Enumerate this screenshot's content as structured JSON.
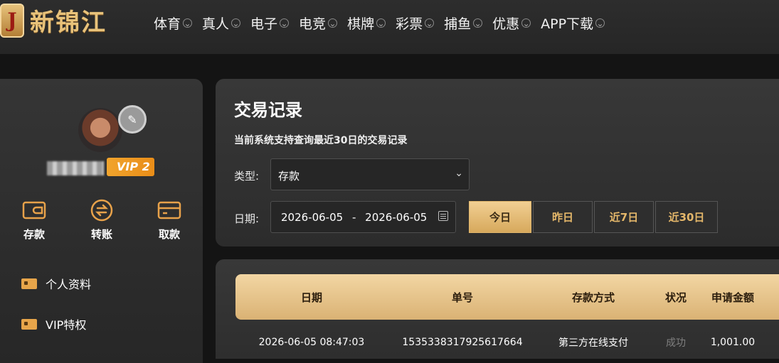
{
  "brand": {
    "logo_letter": "J",
    "name": "新锦江"
  },
  "nav": {
    "items": [
      {
        "label": "体育"
      },
      {
        "label": "真人"
      },
      {
        "label": "电子"
      },
      {
        "label": "电竞"
      },
      {
        "label": "棋牌"
      },
      {
        "label": "彩票"
      },
      {
        "label": "捕鱼"
      },
      {
        "label": "优惠"
      },
      {
        "label": "APP下载"
      }
    ]
  },
  "profile": {
    "vip_label": "VIP 2"
  },
  "wallet_actions": [
    {
      "label": "存款",
      "icon": "wallet-icon"
    },
    {
      "label": "转账",
      "icon": "transfer-icon"
    },
    {
      "label": "取款",
      "icon": "card-icon"
    }
  ],
  "menu": [
    {
      "label": "个人资料"
    },
    {
      "label": "VIP特权"
    }
  ],
  "page": {
    "title": "交易记录",
    "subtitle": "当前系统支持查询最近30日的交易记录",
    "type_label": "类型:",
    "type_value": "存款",
    "date_label": "日期:",
    "date_start": "2026-06-05",
    "date_sep": "-",
    "date_end": "2026-06-05",
    "quick": [
      {
        "label": "今日",
        "active": true
      },
      {
        "label": "昨日"
      },
      {
        "label": "近7日"
      },
      {
        "label": "近30日"
      }
    ]
  },
  "table": {
    "headers": [
      "日期",
      "单号",
      "存款方式",
      "状况",
      "申请金额"
    ],
    "rows": [
      [
        "2026-06-05 08:47:03",
        "1535338317925617664",
        "第三方在线支付",
        "成功",
        "1,001.00"
      ]
    ]
  },
  "colors": {
    "accent_gold": "#e4b76a",
    "vip_orange": "#ef9d26",
    "background": "#141414"
  }
}
